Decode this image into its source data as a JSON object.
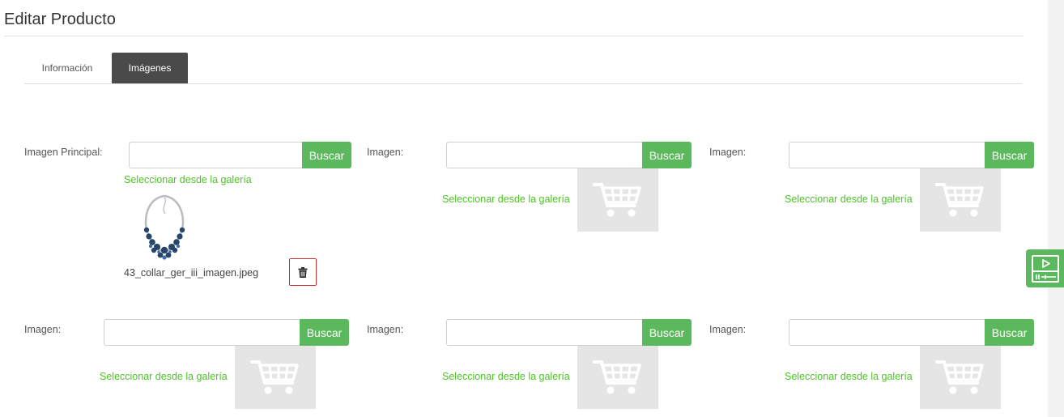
{
  "page": {
    "title": "Editar Producto"
  },
  "tabs": [
    {
      "label": "Información",
      "active": false
    },
    {
      "label": "Imágenes",
      "active": true
    }
  ],
  "colors": {
    "accent": "#5cb85c",
    "link": "#4cc424",
    "tab_active_bg": "#4a4a4a",
    "danger": "#c9302c"
  },
  "image_slots": [
    {
      "label": "Imagen Principal:",
      "value": "",
      "button": "Buscar",
      "gallery_link": "Seleccionar desde la galería",
      "file_name": "43_collar_ger_iii_imagen.jpeg",
      "preview": "necklace-thumbnail"
    },
    {
      "label": "Imagen:",
      "value": "",
      "button": "Buscar",
      "gallery_link": "Seleccionar desde la galería",
      "preview": "cart-placeholder-icon"
    },
    {
      "label": "Imagen:",
      "value": "",
      "button": "Buscar",
      "gallery_link": "Seleccionar desde la galería",
      "preview": "cart-placeholder-icon"
    },
    {
      "label": "Imagen:",
      "value": "",
      "button": "Buscar",
      "gallery_link": "Seleccionar desde la galería",
      "preview": "cart-placeholder-icon"
    },
    {
      "label": "Imagen:",
      "value": "",
      "button": "Buscar",
      "gallery_link": "Seleccionar desde la galería",
      "preview": "cart-placeholder-icon"
    },
    {
      "label": "Imagen:",
      "value": "",
      "button": "Buscar",
      "gallery_link": "Seleccionar desde la galería",
      "preview": "cart-placeholder-icon"
    }
  ],
  "icons": {
    "delete": "trash-icon",
    "widget": "video-player-icon"
  }
}
